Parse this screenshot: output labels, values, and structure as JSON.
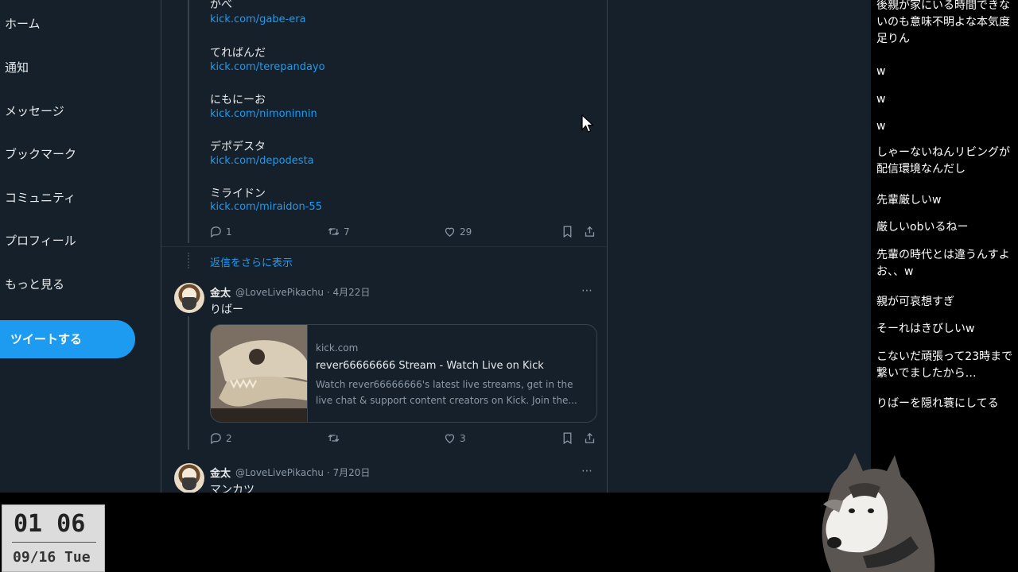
{
  "sidebar": {
    "items": [
      {
        "label": "ホーム"
      },
      {
        "label": "通知"
      },
      {
        "label": "メッセージ"
      },
      {
        "label": "ブックマーク"
      },
      {
        "label": "コミュニティ"
      },
      {
        "label": "プロフィール"
      },
      {
        "label": "もっと見る"
      }
    ],
    "tweet_button": "ツイートする"
  },
  "thread": {
    "entries": [
      {
        "name": "がべ",
        "link": "kick.com/gabe-era"
      },
      {
        "name": "てればんだ",
        "link": "kick.com/terepandayo"
      },
      {
        "name": "にもにーお",
        "link": "kick.com/nimoninnin"
      },
      {
        "name": "デポデスタ",
        "link": "kick.com/depodesta"
      },
      {
        "name": "ミライドン",
        "link": "kick.com/miraidon-55"
      }
    ],
    "actions": {
      "replies": "1",
      "retweets": "7",
      "likes": "29"
    },
    "show_more": "返信をさらに表示"
  },
  "tweets": [
    {
      "name": "金太",
      "handle": "@LoveLivePikachu · 4月22日",
      "text": "りばー",
      "card": {
        "domain": "kick.com",
        "title": "rever66666666 Stream - Watch Live on Kick",
        "description": "Watch rever66666666's latest live streams, get in the live chat & support content creators on Kick. Join the..."
      },
      "actions": {
        "replies": "2",
        "retweets": "",
        "likes": "3"
      }
    },
    {
      "name": "金太",
      "handle": "@LoveLivePikachu · 7月20日",
      "text": "マンカツ"
    }
  ],
  "chat": {
    "messages": [
      "後親が家にいる時間できないのも意味不明よな本気度足りん",
      "w",
      "w",
      "w",
      "しゃーないねんリビングが配信環境なんだし",
      "先輩厳しいw",
      "厳しいobいるねー",
      "先輩の時代とは違うんすよお、、w",
      "親が可哀想すぎ",
      "そーれはきびしいw",
      "こないだ頑張って23時まで繋いでましたから…",
      "りばーを隠れ蓑にしてる"
    ]
  },
  "clock": {
    "time": "01 06",
    "date": "09/16 Tue"
  },
  "colors": {
    "background": "#15202b",
    "accent": "#1d9bf0",
    "text": "#e7e9ea",
    "muted": "#8b98a5",
    "border": "#38444d"
  }
}
